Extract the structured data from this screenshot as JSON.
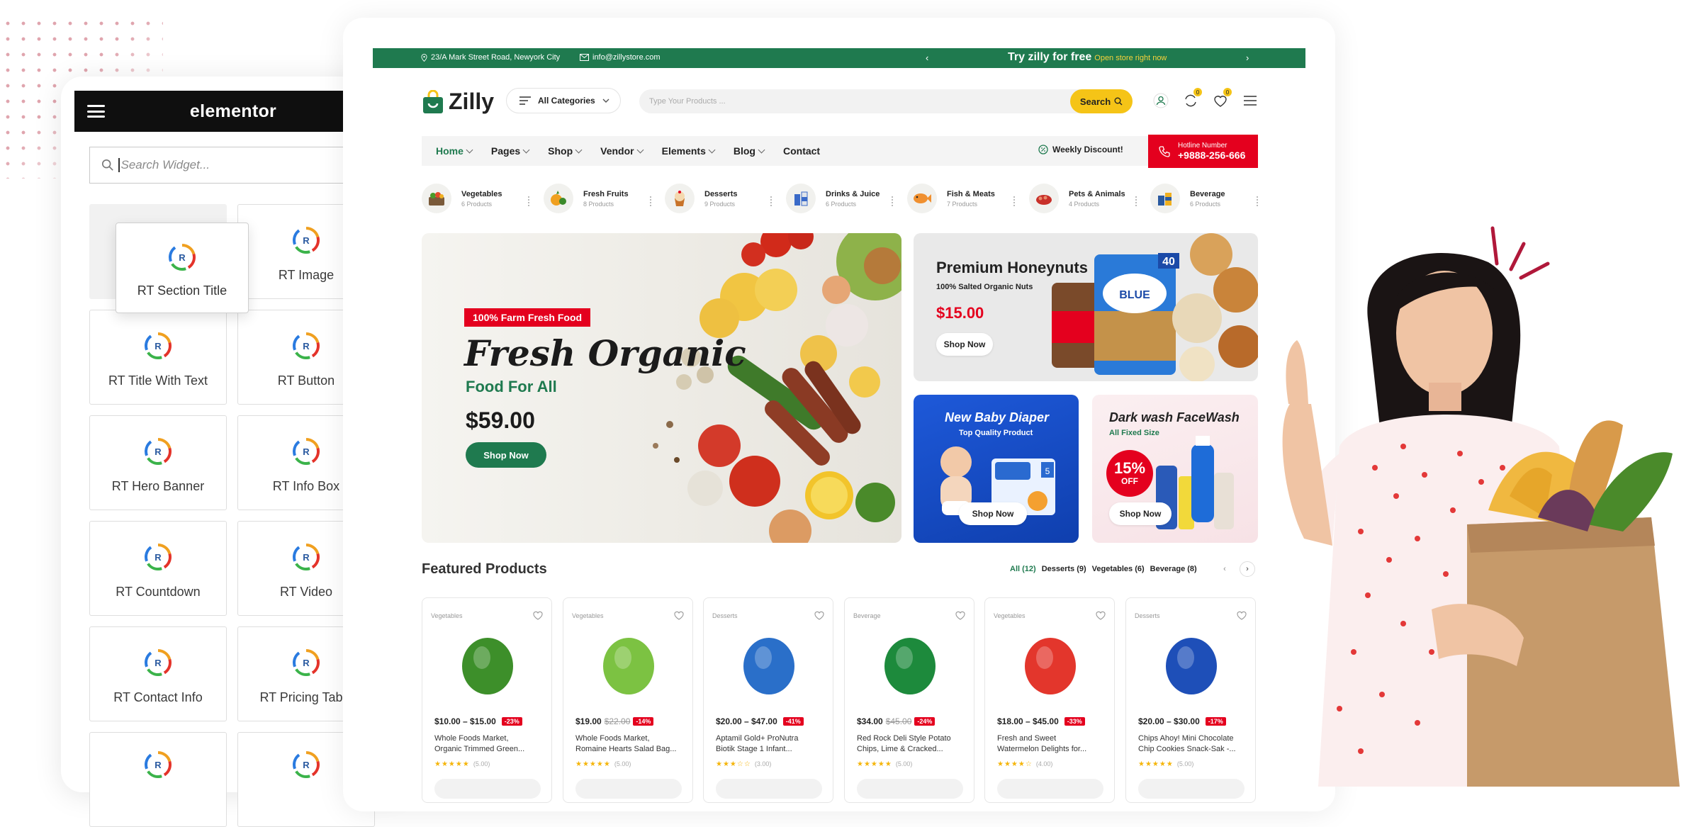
{
  "elementor": {
    "brand": "elementor",
    "search_placeholder": "Search Widget...",
    "widgets": [
      {
        "label": "RT Section Title"
      },
      {
        "label": "RT Image"
      },
      {
        "label": "RT Title With Text"
      },
      {
        "label": "RT Button"
      },
      {
        "label": "RT Hero Banner"
      },
      {
        "label": "RT Info Box"
      },
      {
        "label": "RT Countdown"
      },
      {
        "label": "RT Video"
      },
      {
        "label": "RT Contact Info"
      },
      {
        "label": "RT Pricing Table"
      }
    ]
  },
  "topbar": {
    "address": "23/A Mark Street Road, Newyork City",
    "email": "info@zillystore.com",
    "promo": "Try zilly for free",
    "promo_sub": "Open store right now"
  },
  "header": {
    "logo": "Zilly",
    "all_categories": "All Categories",
    "search_placeholder": "Type Your Products ...",
    "search_button": "Search",
    "cart_count": "0",
    "wish_count": "0"
  },
  "nav": {
    "items": [
      "Home",
      "Pages",
      "Shop",
      "Vendor",
      "Elements",
      "Blog",
      "Contact"
    ],
    "weekly": "Weekly Discount!",
    "hotline_label": "Hotline Number",
    "hotline_number": "+9888-256-666"
  },
  "categories": [
    {
      "name": "Vegetables",
      "count": "6 Products"
    },
    {
      "name": "Fresh Fruits",
      "count": "8 Products"
    },
    {
      "name": "Desserts",
      "count": "9 Products"
    },
    {
      "name": "Drinks & Juice",
      "count": "6 Products"
    },
    {
      "name": "Fish & Meats",
      "count": "7 Products"
    },
    {
      "name": "Pets & Animals",
      "count": "4 Products"
    },
    {
      "name": "Beverage",
      "count": "6 Products"
    }
  ],
  "hero": {
    "tag": "100% Farm Fresh Food",
    "title": "Fresh Organic",
    "subtitle": "Food For All",
    "price": "$59.00",
    "button": "Shop Now"
  },
  "banners": {
    "honeynuts": {
      "title": "Premium Honeynuts",
      "subtitle": "100% Salted Organic Nuts",
      "price": "$15.00",
      "button": "Shop Now",
      "pack_number": "40"
    },
    "diaper": {
      "title": "New Baby Diaper",
      "subtitle": "Top Quality Product",
      "button": "Shop Now"
    },
    "facewash": {
      "title": "Dark wash FaceWash",
      "subtitle": "All Fixed Size",
      "badge_big": "15%",
      "badge_small": "OFF",
      "button": "Shop Now"
    }
  },
  "featured": {
    "title": "Featured Products",
    "tabs": [
      "All (12)",
      "Desserts (9)",
      "Vegetables (6)",
      "Beverage (8)"
    ],
    "products": [
      {
        "category": "Vegetables",
        "price": "$10.00 – $15.00",
        "old": "",
        "discount": "-23%",
        "name1": "Whole Foods Market,",
        "name2": "Organic Trimmed Green...",
        "stars": "★★★★★",
        "rating": "(5.00)",
        "color": "#3d8f2a"
      },
      {
        "category": "Vegetables",
        "price": "$19.00",
        "old": "$22.00",
        "discount": "-14%",
        "name1": "Whole Foods Market,",
        "name2": "Romaine Hearts Salad Bag...",
        "stars": "★★★★★",
        "rating": "(5.00)",
        "color": "#7cc242"
      },
      {
        "category": "Desserts",
        "price": "$20.00 – $47.00",
        "old": "",
        "discount": "-41%",
        "name1": "Aptamil Gold+ ProNutra",
        "name2": "Biotik Stage 1 Infant...",
        "stars": "★★★☆☆",
        "rating": "(3.00)",
        "color": "#2a6fc9"
      },
      {
        "category": "Beverage",
        "price": "$34.00",
        "old": "$45.00",
        "discount": "-24%",
        "name1": "Red Rock Deli Style Potato",
        "name2": "Chips, Lime & Cracked...",
        "stars": "★★★★★",
        "rating": "(5.00)",
        "color": "#1d8a3c"
      },
      {
        "category": "Vegetables",
        "price": "$18.00 – $45.00",
        "old": "",
        "discount": "-33%",
        "name1": "Fresh and Sweet",
        "name2": "Watermelon Delights for...",
        "stars": "★★★★☆",
        "rating": "(4.00)",
        "color": "#e3362c"
      },
      {
        "category": "Desserts",
        "price": "$20.00 – $30.00",
        "old": "",
        "discount": "-17%",
        "name1": "Chips Ahoy! Mini Chocolate",
        "name2": "Chip Cookies Snack-Sak -...",
        "stars": "★★★★★",
        "rating": "(5.00)",
        "color": "#1e4fb8"
      }
    ]
  },
  "colors": {
    "green": "#1f7a4f",
    "red": "#e4001e",
    "yellow": "#f5c417",
    "dark": "#0f0f0f"
  }
}
